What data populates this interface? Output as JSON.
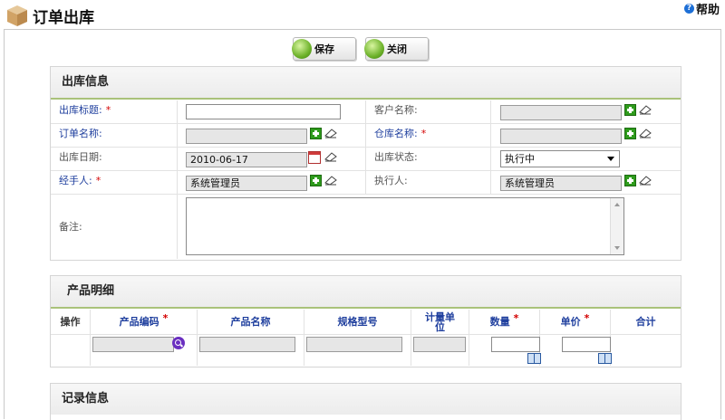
{
  "page": {
    "title": "订单出库",
    "help_label": "帮助"
  },
  "toolbar": {
    "save_label": "保存",
    "close_label": "关闭"
  },
  "outbound_info": {
    "section_title": "出库信息",
    "title_label": "出库标题:",
    "customer_label": "客户名称:",
    "order_label": "订单名称:",
    "warehouse_label": "仓库名称:",
    "date_label": "出库日期:",
    "date_value": "2010-06-17",
    "status_label": "出库状态:",
    "status_value": "执行中",
    "handler_label": "经手人:",
    "handler_value": "系统管理员",
    "executor_label": "执行人:",
    "executor_value": "系统管理员",
    "notes_label": "备注:",
    "required_mark": "*"
  },
  "product_detail": {
    "section_title": "产品明细",
    "columns": [
      "操作",
      "产品编码",
      "产品名称",
      "规格型号",
      "计量单位",
      "数量",
      "单价",
      "合计"
    ]
  },
  "record_info": {
    "section_title": "记录信息"
  },
  "colors": {
    "required": "#d40000",
    "label_required": "#1f3f9e",
    "accent": "#a9c27a"
  }
}
